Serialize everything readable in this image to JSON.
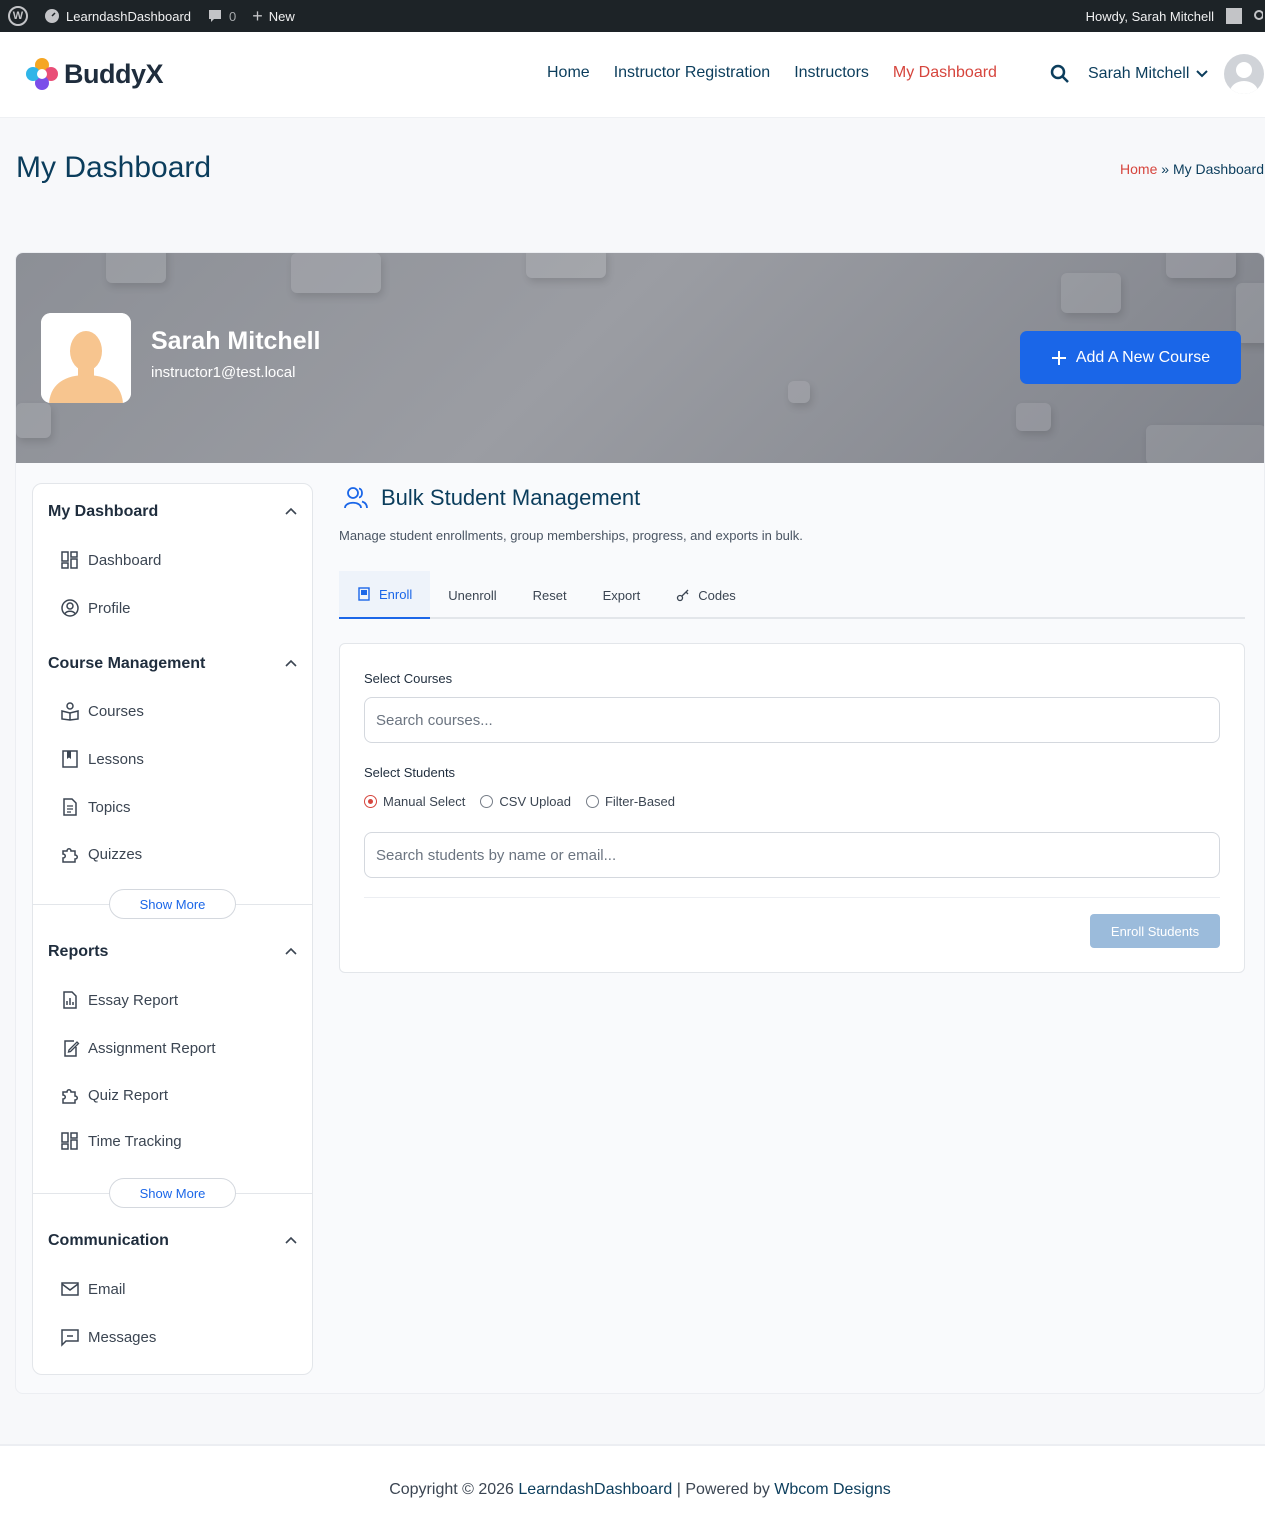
{
  "admin_bar": {
    "site_name": "LearndashDashboard",
    "comments_count": "0",
    "new_label": "New",
    "howdy": "Howdy, Sarah Mitchell"
  },
  "header": {
    "logo_text": "BuddyX",
    "nav": [
      "Home",
      "Instructor Registration",
      "Instructors",
      "My Dashboard"
    ],
    "active_nav": "My Dashboard",
    "user_name": "Sarah Mitchell"
  },
  "page": {
    "title": "My Dashboard",
    "breadcrumb_home": "Home",
    "breadcrumb_sep": "»",
    "breadcrumb_current": "My Dashboard"
  },
  "profile": {
    "name": "Sarah Mitchell",
    "email": "instructor1@test.local",
    "add_course_label": "Add A New Course"
  },
  "sidebar": {
    "sections": [
      {
        "title": "My Dashboard",
        "items": [
          "Dashboard",
          "Profile"
        ]
      },
      {
        "title": "Course Management",
        "items": [
          "Courses",
          "Lessons",
          "Topics",
          "Quizzes"
        ],
        "show_more": "Show More"
      },
      {
        "title": "Reports",
        "items": [
          "Essay Report",
          "Assignment Report",
          "Quiz Report",
          "Time Tracking"
        ],
        "show_more": "Show More"
      },
      {
        "title": "Communication",
        "items": [
          "Email",
          "Messages"
        ]
      }
    ]
  },
  "content": {
    "title": "Bulk Student Management",
    "description": "Manage student enrollments, group memberships, progress, and exports in bulk.",
    "tabs": [
      "Enroll",
      "Unenroll",
      "Reset",
      "Export",
      "Codes"
    ],
    "active_tab": "Enroll",
    "select_courses_label": "Select Courses",
    "courses_placeholder": "Search courses...",
    "select_students_label": "Select Students",
    "radio_options": [
      "Manual Select",
      "CSV Upload",
      "Filter-Based"
    ],
    "radio_selected": "Manual Select",
    "students_placeholder": "Search students by name or email...",
    "enroll_button": "Enroll Students"
  },
  "footer": {
    "prefix": "Copyright © 2026",
    "site_link": "LearndashDashboard",
    "middle": "| Powered by",
    "powered_link": "Wbcom Designs"
  },
  "colors": {
    "accent": "#1a66e8",
    "active_nav": "#d6453d",
    "heading": "#0b3d5c"
  }
}
